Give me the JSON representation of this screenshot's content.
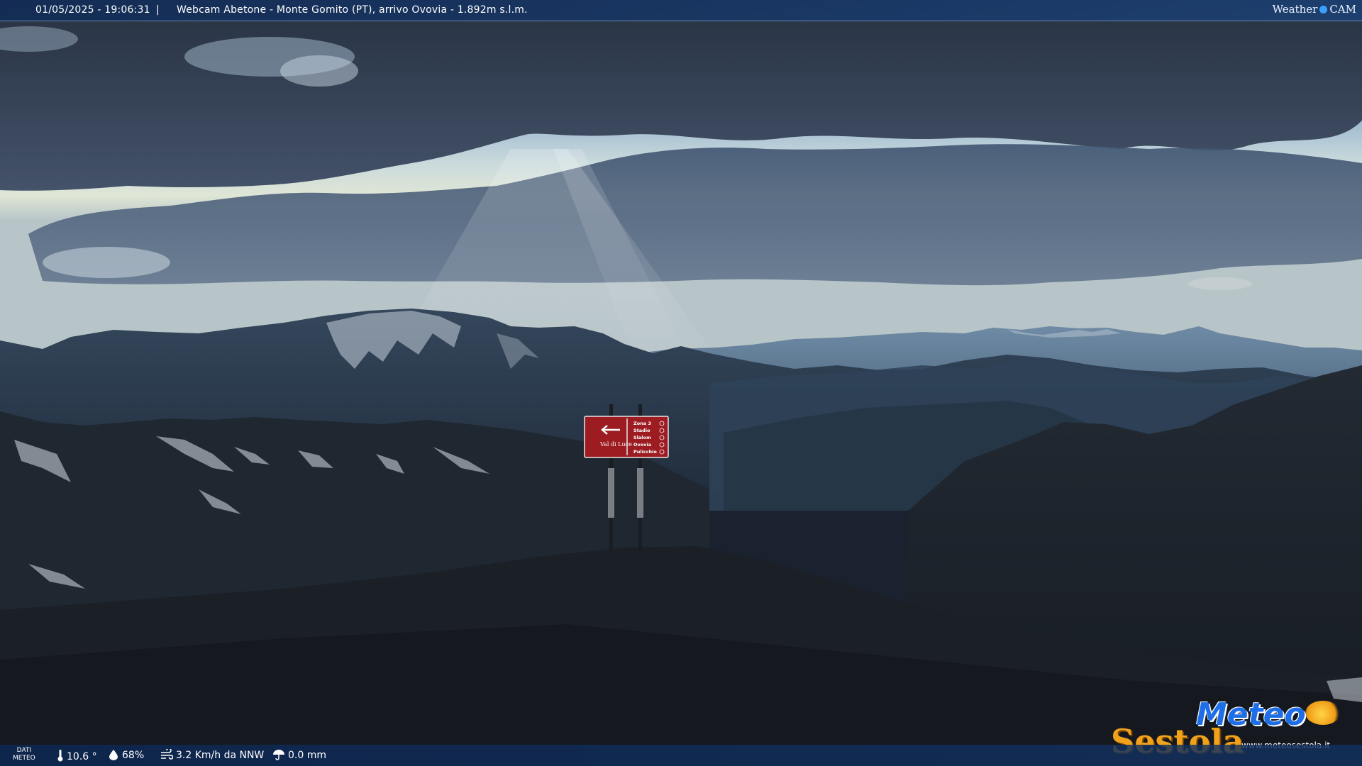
{
  "header": {
    "datetime": "01/05/2025 - 19:06:31",
    "separator": "|",
    "title": "Webcam Abetone - Monte Gomito (PT), arrivo Ovovia - 1.892m s.l.m.",
    "brand_left": "Weather",
    "brand_right": "CAM"
  },
  "sign": {
    "left_label": "Val di Luce",
    "right_lines": [
      "Zona 3",
      "Stadio",
      "Slalom",
      "Ovovia",
      "Pulicchio"
    ],
    "color": "#9c1c22"
  },
  "footer": {
    "dati_line1": "DATI",
    "dati_line2": "METEO",
    "temperature": "10.6 °",
    "humidity": "68%",
    "wind": "3.2 Km/h da NNW",
    "rain": "0.0 mm"
  },
  "logo": {
    "word1": "Meteo",
    "word2": "Sestola",
    "url": "www.meteosestola.it"
  },
  "icons": {
    "temperature": "thermometer-icon",
    "humidity": "water-drop-icon",
    "wind": "wind-icon",
    "rain": "umbrella-icon"
  },
  "colors": {
    "bar": "#123262",
    "sign": "#9c1c22",
    "logo_blue": "#1e6ee8",
    "logo_orange": "#f0a21c"
  }
}
